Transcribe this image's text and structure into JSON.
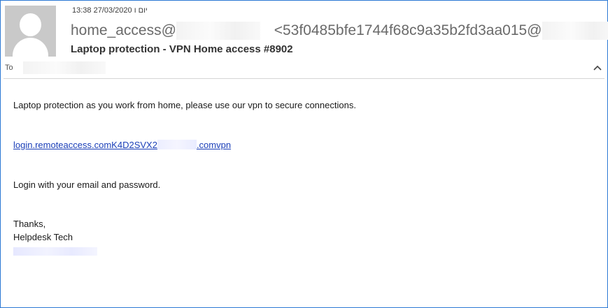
{
  "header": {
    "datetime": "13:38 27/03/2020 יום ו",
    "sender_name": "home_access@",
    "sender_address_prefix": "<53f0485bfe1744f68c9a35b2fd3aa015@",
    "subject": "Laptop protection - VPN Home access #8902",
    "to_label": "To"
  },
  "body": {
    "line1": "Laptop protection as you work from home, please use our vpn to secure connections.",
    "link_start": "login.remoteaccess.comK4D2SVX2",
    "link_end": ".comvpn",
    "line3": "Login with your email and password.",
    "closing": "Thanks,",
    "signature": "Helpdesk Tech"
  },
  "icons": {
    "avatar": "person-placeholder-icon",
    "collapse": "chevron-up-icon"
  },
  "colors": {
    "window_border": "#2b78d4",
    "link": "#1b3fb8",
    "avatar_bg": "#c9c9c9"
  }
}
